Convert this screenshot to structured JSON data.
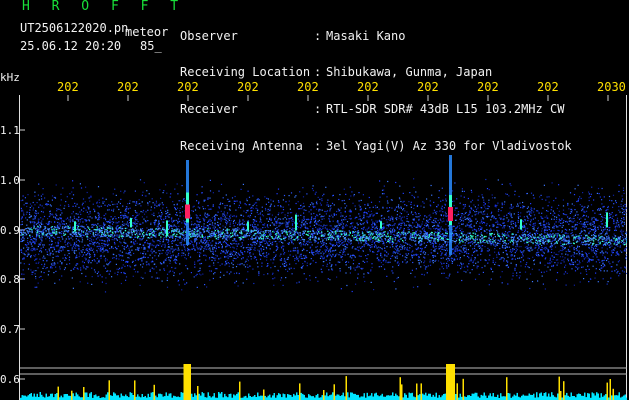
{
  "header": {
    "title": "H R O F F T",
    "filename": "UT2506122020.pn",
    "type_label": "meteor",
    "date": "25.06.12 20:20",
    "count": "85_"
  },
  "station": {
    "labels": [
      "Observer",
      "Receiving Location",
      "Receiver",
      "Receiving Antenna"
    ],
    "colons": [
      ":",
      ":",
      ":",
      ":"
    ],
    "values": [
      "Masaki Kano",
      "Shibukawa, Gunma, Japan",
      "RTL-SDR SDR# 43dB L15 103.2MHz CW",
      "3el Yagi(V) Az 330 for Vladivostok"
    ]
  },
  "yaxis": {
    "unit": "kHz",
    "ticks": [
      "1.1",
      "1.0",
      "0.9",
      "0.8",
      "0.7",
      "0.6"
    ]
  },
  "xaxis": {
    "ticks": [
      "202",
      "202",
      "202",
      "202",
      "202",
      "202",
      "202",
      "202",
      "202",
      "2030"
    ]
  },
  "colors": {
    "background": "#000000",
    "header_green": "#19e03a",
    "tick_yellow": "#ffe000",
    "noise_blue": "#1f3cff",
    "echo_red": "#ff2060",
    "power_cyan": "#00e5ff",
    "power_peak_yellow": "#ffe000"
  }
}
